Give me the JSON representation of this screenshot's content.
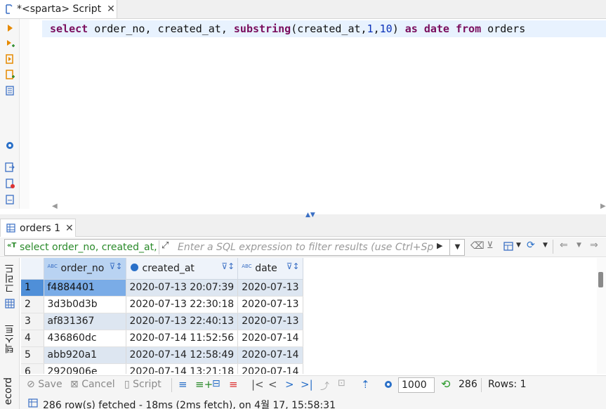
{
  "editor_tab": {
    "title": "*<sparta> Script"
  },
  "editor": {
    "sql": {
      "kw_select": "select",
      "part1": " order_no, created_at, ",
      "kw_substring": "substring",
      "part2": "(created_at,",
      "num1": "1",
      "comma": ",",
      "num2": "10",
      "part3": ") ",
      "kw_as": "as",
      "sp1": " ",
      "kw_date": "date",
      "sp2": " ",
      "kw_from": "from",
      "part4": " orders"
    }
  },
  "results_tab": {
    "title": "orders 1"
  },
  "filter": {
    "query_text": "select order_no, created_at, s",
    "placeholder": "Enter a SQL expression to filter results (use Ctrl+Spac"
  },
  "side_tabs": {
    "grid": "그리드",
    "text": "텍스트",
    "record": "ecord"
  },
  "grid": {
    "columns": [
      "order_no",
      "created_at",
      "date"
    ],
    "rows": [
      {
        "n": "1",
        "order_no": "f4884401",
        "created_at": "2020-07-13 20:07:39",
        "date": "2020-07-13"
      },
      {
        "n": "2",
        "order_no": "3d3b0d3b",
        "created_at": "2020-07-13 22:30:18",
        "date": "2020-07-13"
      },
      {
        "n": "3",
        "order_no": "af831367",
        "created_at": "2020-07-13 22:40:13",
        "date": "2020-07-13"
      },
      {
        "n": "4",
        "order_no": "436860dc",
        "created_at": "2020-07-14 11:52:56",
        "date": "2020-07-14"
      },
      {
        "n": "5",
        "order_no": "abb920a1",
        "created_at": "2020-07-14 12:58:49",
        "date": "2020-07-14"
      },
      {
        "n": "6",
        "order_no": "2920906e",
        "created_at": "2020-07-14 13:21:18",
        "date": "2020-07-14"
      }
    ]
  },
  "bottom": {
    "save": "Save",
    "cancel": "Cancel",
    "script": "Script",
    "fetch_size": "1000",
    "row_count": "286",
    "rows_label": "Rows: 1"
  },
  "status": {
    "text": "286 row(s) fetched - 18ms (2ms fetch), on 4월 17, 15:58:31"
  },
  "colors": {
    "accent": "#4f8fd8",
    "selected_cell": "#7aace7",
    "keyword": "#7a0e5e",
    "number": "#0a30b8",
    "alt_row": "#dde6f1"
  }
}
